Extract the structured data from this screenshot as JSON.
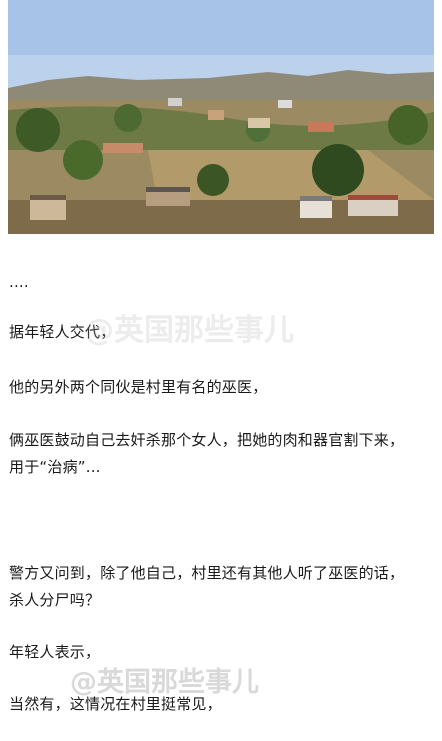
{
  "article": {
    "ellipsis": "....",
    "p1": "据年轻人交代，",
    "p2": "他的另外两个同伙是村里有名的巫医，",
    "p3_line1": "俩巫医鼓动自己去奸杀那个女人，把她的肉和器官割下来，",
    "p3_line2": "用于“治病”...",
    "p4_line1": "警方又问到，除了他自己，村里还有其他人听了巫医的话，",
    "p4_line2": "杀人分尸吗？",
    "p5": "年轻人表示，",
    "p6": "当然有，这情况在村里挺常见，"
  },
  "watermark": {
    "text": "@英国那些事儿"
  }
}
